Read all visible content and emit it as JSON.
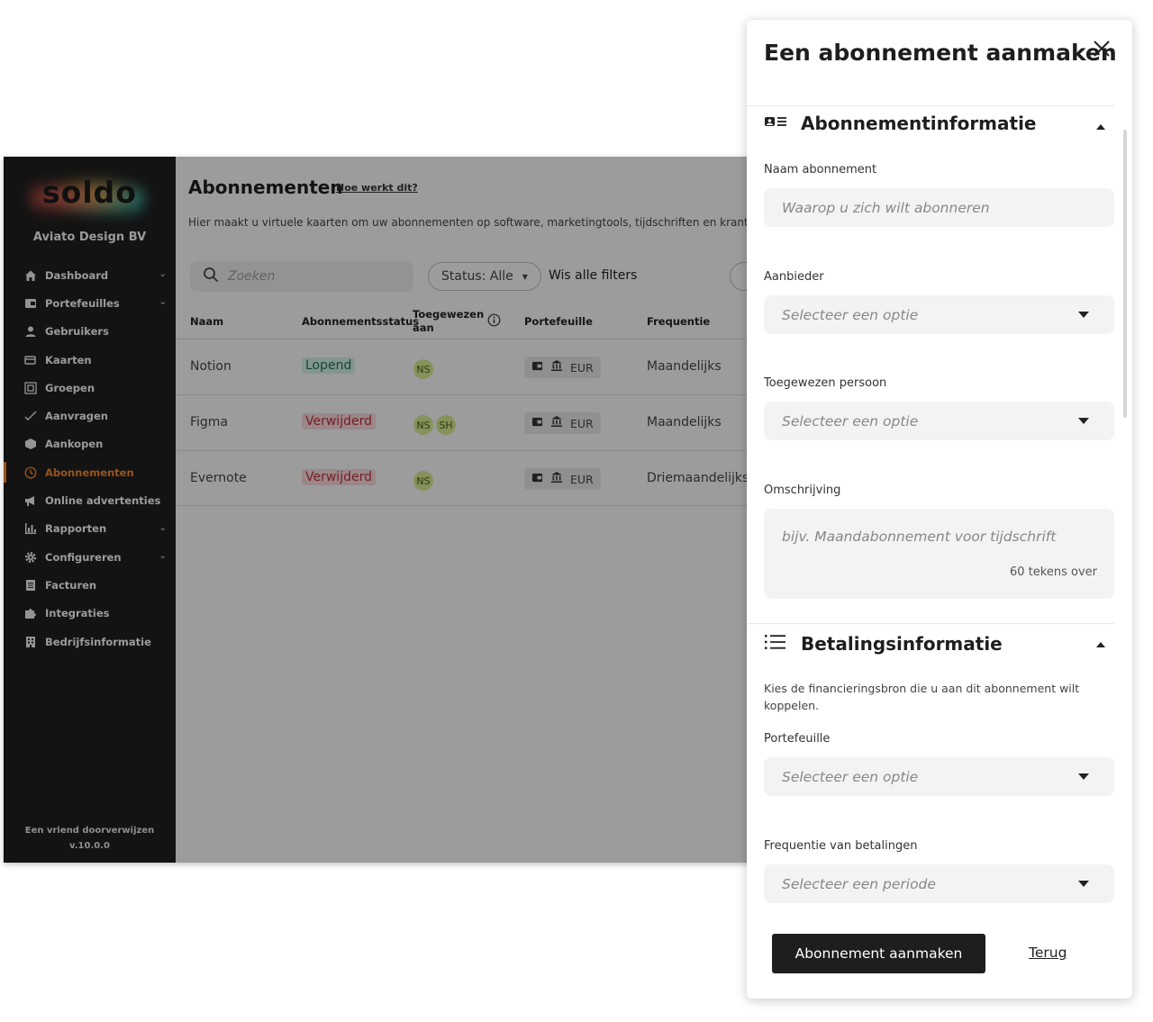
{
  "sidebar": {
    "logo": "soldo",
    "company": "Aviato Design BV",
    "items": [
      {
        "label": "Dashboard",
        "icon": "home-icon",
        "has_submenu": true
      },
      {
        "label": "Portefeuilles",
        "icon": "wallet-icon",
        "has_submenu": true
      },
      {
        "label": "Gebruikers",
        "icon": "person-icon",
        "has_submenu": false
      },
      {
        "label": "Kaarten",
        "icon": "cards-icon",
        "has_submenu": false
      },
      {
        "label": "Groepen",
        "icon": "groups-icon",
        "has_submenu": false
      },
      {
        "label": "Aanvragen",
        "icon": "check-icon",
        "has_submenu": false
      },
      {
        "label": "Aankopen",
        "icon": "box-icon",
        "has_submenu": false
      },
      {
        "label": "Abonnementen",
        "icon": "clock-icon",
        "has_submenu": false,
        "active": true
      },
      {
        "label": "Online advertenties",
        "icon": "megaphone-icon",
        "has_submenu": false
      },
      {
        "label": "Rapporten",
        "icon": "chart-icon",
        "has_submenu": true
      },
      {
        "label": "Configureren",
        "icon": "gear-icon",
        "has_submenu": true
      },
      {
        "label": "Facturen",
        "icon": "invoice-icon",
        "has_submenu": false
      },
      {
        "label": "Integraties",
        "icon": "puzzle-icon",
        "has_submenu": false
      },
      {
        "label": "Bedrijfsinformatie",
        "icon": "building-icon",
        "has_submenu": false
      }
    ],
    "footer_link": "Een vriend doorverwijzen",
    "version": "v.10.0.0"
  },
  "main": {
    "title": "Abonnementen",
    "help_link": "Hoe werkt dit?",
    "subtitle": "Hier maakt u virtuele kaarten om uw abonnementen op software, marketingtools, tijdschriften en kranten te beheren.",
    "search_placeholder": "Zoeken",
    "status_filter": "Status: Alle",
    "clear_filters": "Wis alle filters",
    "columns": {
      "name": "Naam",
      "status": "Abonnementsstatus",
      "assigned_line1": "Toegewezen",
      "assigned_line2": "aan",
      "wallet": "Portefeuille",
      "frequency": "Frequentie"
    },
    "rows": [
      {
        "name": "Notion",
        "status": "Lopend",
        "status_type": "active",
        "assignees": [
          "NS"
        ],
        "currency": "EUR",
        "frequency": "Maandelijks"
      },
      {
        "name": "Figma",
        "status": "Verwijderd",
        "status_type": "deleted",
        "assignees": [
          "NS",
          "SH"
        ],
        "currency": "EUR",
        "frequency": "Maandelijks"
      },
      {
        "name": "Evernote",
        "status": "Verwijderd",
        "status_type": "deleted",
        "assignees": [
          "NS"
        ],
        "currency": "EUR",
        "frequency": "Driemaandelijks"
      }
    ]
  },
  "drawer": {
    "title": "Een abonnement aanmaken",
    "section_info": {
      "title": "Abonnementinformatie",
      "name_label": "Naam abonnement",
      "name_placeholder": "Waarop u zich wilt abonneren",
      "provider_label": "Aanbieder",
      "provider_value": "Selecteer een optie",
      "assignee_label": "Toegewezen persoon",
      "assignee_value": "Selecteer een optie",
      "description_label": "Omschrijving",
      "description_placeholder": "bijv. Maandabonnement voor tijdschrift",
      "description_counter": "60 tekens over"
    },
    "section_payment": {
      "title": "Betalingsinformatie",
      "helper": "Kies de financieringsbron die u aan dit abonnement wilt koppelen.",
      "wallet_label": "Portefeuille",
      "wallet_value": "Selecteer een optie",
      "frequency_label": "Frequentie van betalingen",
      "frequency_value": "Selecteer een periode"
    },
    "primary_button": "Abonnement aanmaken",
    "back_link": "Terug"
  },
  "colors": {
    "sidebar_bg": "#1e1e1e",
    "accent_active": "#f0822e",
    "status_active_bg": "#cfe9df",
    "status_deleted_bg": "#f2d3d5",
    "primary_button_bg": "#1e1e1e",
    "avatar_bg": "#d4e58d"
  }
}
